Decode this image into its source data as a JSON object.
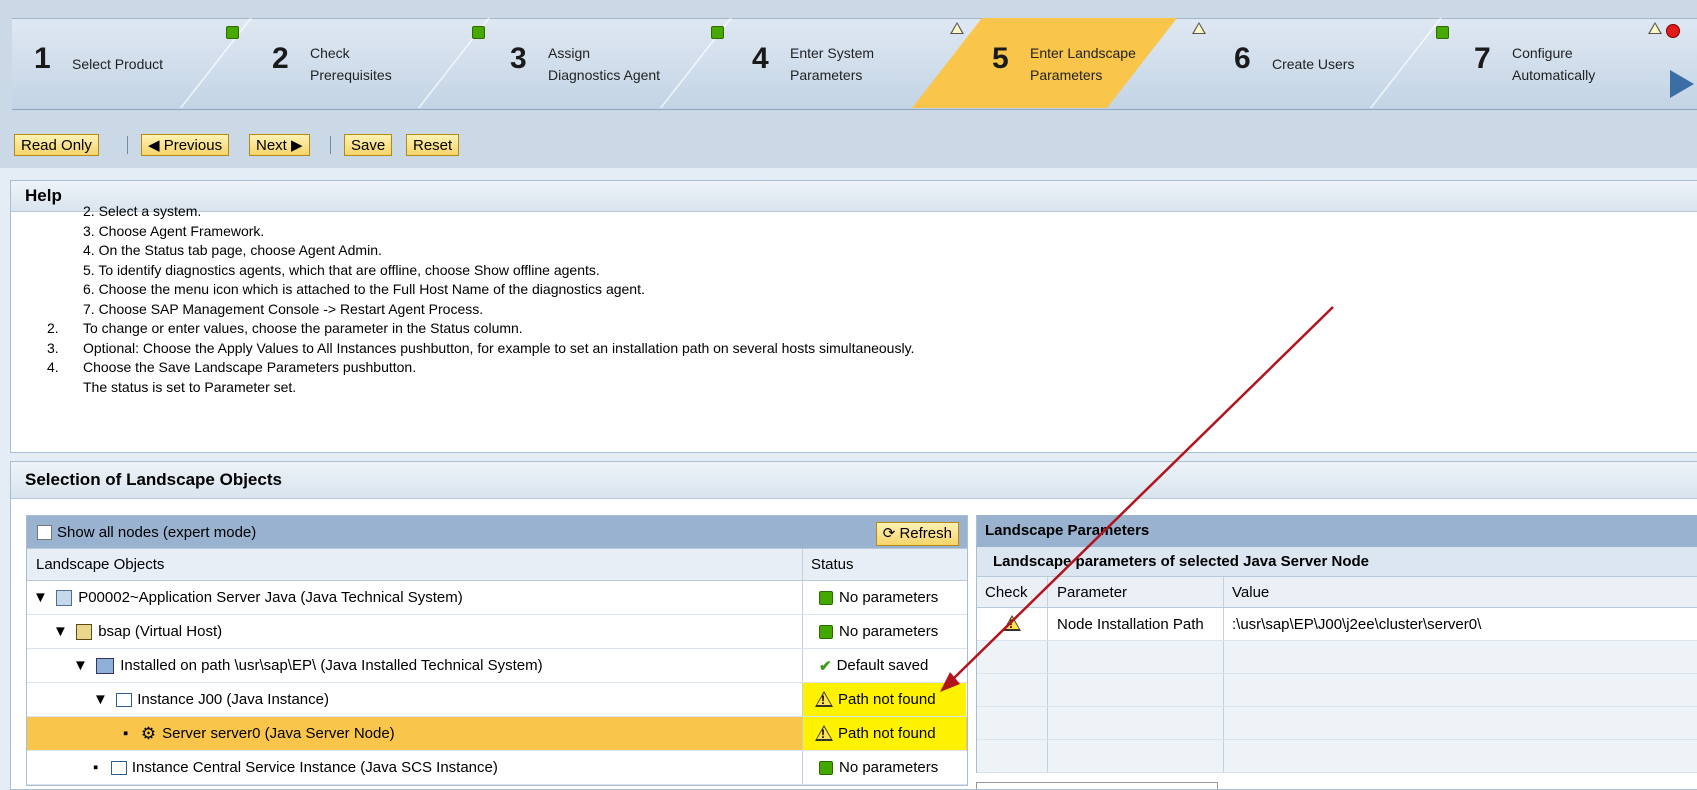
{
  "steps": [
    {
      "num": "1",
      "label": "Select Product"
    },
    {
      "num": "2",
      "label": "Check Prerequisites",
      "l1": "Check",
      "l2": "Prerequisites"
    },
    {
      "num": "3",
      "label": "Assign Diagnostics Agent",
      "l1": "Assign",
      "l2": "Diagnostics Agent"
    },
    {
      "num": "4",
      "label": "Enter System Parameters",
      "l1": "Enter System",
      "l2": "Parameters"
    },
    {
      "num": "5",
      "label": "Enter Landscape Parameters",
      "l1": "Enter Landscape",
      "l2": "Parameters"
    },
    {
      "num": "6",
      "label": "Create Users"
    },
    {
      "num": "7",
      "label": "Configure Automatically",
      "l1": "Configure",
      "l2": "Automatically"
    }
  ],
  "toolbar": {
    "read_only": "Read Only",
    "previous": "◀ Previous",
    "next": "Next ▶",
    "save": "Save",
    "reset": "Reset"
  },
  "help": {
    "title": "Help",
    "lines": [
      {
        "n": "",
        "text": "2. Select a system."
      },
      {
        "n": "",
        "text": "3. Choose Agent Framework."
      },
      {
        "n": "",
        "text": "4. On the Status tab page, choose Agent Admin."
      },
      {
        "n": "",
        "text": "5. To identify diagnostics agents, which that are offline, choose Show offline agents."
      },
      {
        "n": "",
        "text": "6. Choose the menu icon which is attached to the Full Host Name of the diagnostics agent."
      },
      {
        "n": "",
        "text": "7. Choose SAP Management Console -> Restart Agent Process."
      },
      {
        "n": "2.",
        "text": "To change or enter values, choose the parameter in the Status column."
      },
      {
        "n": "3.",
        "text": "Optional: Choose the Apply Values to All Instances pushbutton, for example to set an installation path on several hosts simultaneously."
      },
      {
        "n": "4.",
        "text": "Choose the Save Landscape Parameters pushbutton."
      },
      {
        "n": "",
        "text": "The status is set to Parameter set."
      }
    ]
  },
  "selection": {
    "title": "Selection of Landscape Objects",
    "show_all": "Show all nodes (expert mode)",
    "refresh": "Refresh",
    "col_objects": "Landscape Objects",
    "col_status": "Status",
    "rows": [
      {
        "text": "P00002~Application Server Java (Java Technical System)",
        "status": "No parameters"
      },
      {
        "text": "bsap (Virtual Host)",
        "status": "No parameters"
      },
      {
        "text": "Installed on path \\usr\\sap\\EP\\ (Java Installed Technical System)",
        "status": "Default saved"
      },
      {
        "text": "Instance J00 (Java Instance)",
        "status": "Path not found"
      },
      {
        "text": "Server server0 (Java Server Node)",
        "status": "Path not found"
      },
      {
        "text": "Instance Central Service Instance (Java SCS Instance)",
        "status": "No parameters"
      }
    ]
  },
  "params": {
    "title": "Landscape Parameters",
    "subtitle": "Landscape parameters of selected Java Server Node",
    "col_check": "Check",
    "col_param": "Parameter",
    "col_value": "Value",
    "row": {
      "param": "Node Installation Path",
      "value": ":\\usr\\sap\\EP\\J00\\j2ee\\cluster\\server0\\"
    }
  }
}
